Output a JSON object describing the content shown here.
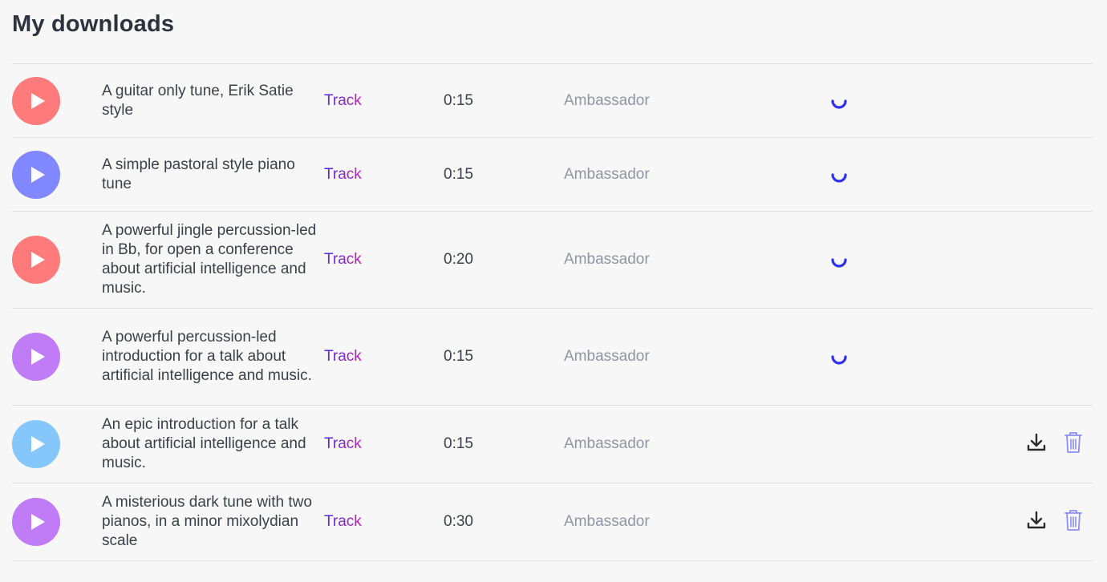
{
  "page": {
    "title": "My downloads"
  },
  "downloads": [
    {
      "title": "A guitar only tune, Erik Satie style",
      "type": "Track",
      "duration": "0:15",
      "plan": "Ambassador",
      "status": "loading",
      "play_color": "#ff7a7a"
    },
    {
      "title": "A simple pastoral style piano tune",
      "type": "Track",
      "duration": "0:15",
      "plan": "Ambassador",
      "status": "loading",
      "play_color": "#8187ff"
    },
    {
      "title": "A powerful jingle percussion-led in Bb, for open a conference about artificial intelligence and music.",
      "type": "Track",
      "duration": "0:20",
      "plan": "Ambassador",
      "status": "loading",
      "play_color": "#ff7a7a"
    },
    {
      "title": "A powerful percussion-led introduction for a talk about artificial intelligence and music.",
      "type": "Track",
      "duration": "0:15",
      "plan": "Ambassador",
      "status": "loading",
      "play_color": "#c07cf7"
    },
    {
      "title": "An epic introduction for a talk about artificial intelligence and music.",
      "type": "Track",
      "duration": "0:15",
      "plan": "Ambassador",
      "status": "ready",
      "play_color": "#85c6fb"
    },
    {
      "title": "A misterious dark tune with two pianos, in a minor mixolydian scale",
      "type": "Track",
      "duration": "0:30",
      "plan": "Ambassador",
      "status": "ready",
      "play_color": "#c07cf7"
    }
  ],
  "icons": {
    "play": "play-icon",
    "loading": "loading-spinner-icon",
    "download": "download-icon",
    "delete": "trash-icon"
  },
  "colors": {
    "spinner": "#2f2ff0",
    "download_icon": "#2b2b2b",
    "delete_icon": "#8a8ef5",
    "type_gradient_start": "#4a2bd9",
    "type_gradient_end": "#c51fb2"
  }
}
